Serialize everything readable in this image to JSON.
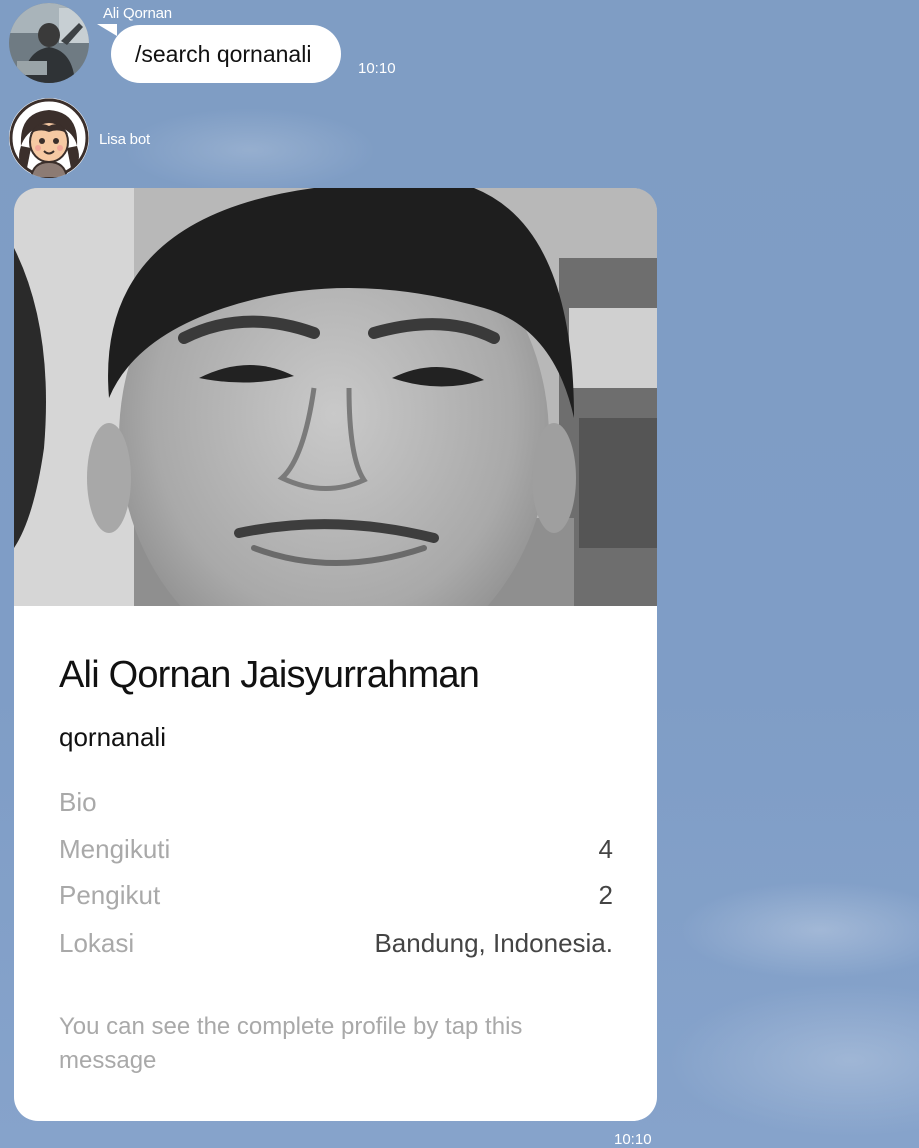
{
  "chat": {
    "user_message": {
      "sender": "Ali Qornan",
      "text": "/search qornanali",
      "time": "10:10",
      "avatar": "user-avatar-photo"
    },
    "bot_message": {
      "sender": "Lisa bot",
      "time": "10:10",
      "avatar": "bot-avatar-cartoon-girl"
    }
  },
  "profile_card": {
    "photo": "profile-photo",
    "full_name": "Ali Qornan Jaisyurrahman",
    "username": "qornanali",
    "rows": {
      "bio": {
        "label": "Bio",
        "value": ""
      },
      "following": {
        "label": "Mengikuti",
        "value": "4"
      },
      "followers": {
        "label": "Pengikut",
        "value": "2"
      },
      "location": {
        "label": "Lokasi",
        "value": "Bandung, Indonesia."
      }
    },
    "footer_text": "You can see the complete profile by tap this message"
  },
  "colors": {
    "background": "#7f9cc4",
    "bubble": "#ffffff",
    "label_gray": "#a9a9a9"
  }
}
